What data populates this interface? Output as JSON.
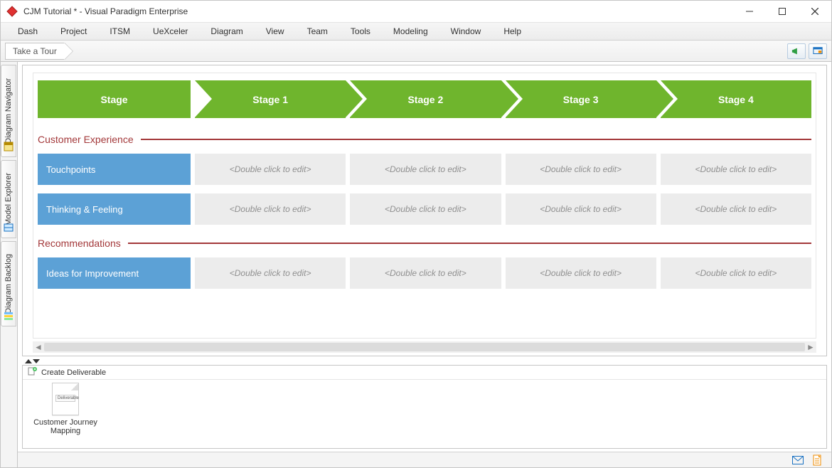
{
  "titlebar": {
    "title": "CJM Tutorial * - Visual Paradigm Enterprise"
  },
  "menu": {
    "items": [
      "Dash",
      "Project",
      "ITSM",
      "UeXceler",
      "Diagram",
      "View",
      "Team",
      "Tools",
      "Modeling",
      "Window",
      "Help"
    ]
  },
  "tourbar": {
    "tab_label": "Take a Tour"
  },
  "side_tabs": {
    "items": [
      "Diagram Navigator",
      "Model Explorer",
      "Diagram Backlog"
    ]
  },
  "journey_map": {
    "placeholder": "<Double click to edit>",
    "stage_header": "Stage",
    "stages": [
      "Stage 1",
      "Stage 2",
      "Stage 3",
      "Stage 4"
    ],
    "sections": [
      {
        "title": "Customer Experience",
        "rows": [
          "Touchpoints",
          "Thinking & Feeling"
        ]
      },
      {
        "title": "Recommendations",
        "rows": [
          "Ideas for Improvement"
        ]
      }
    ]
  },
  "deliverable": {
    "header": "Create Deliverable",
    "thumb_label": "Deliverable",
    "item_label_line1": "Customer Journey",
    "item_label_line2": "Mapping"
  }
}
